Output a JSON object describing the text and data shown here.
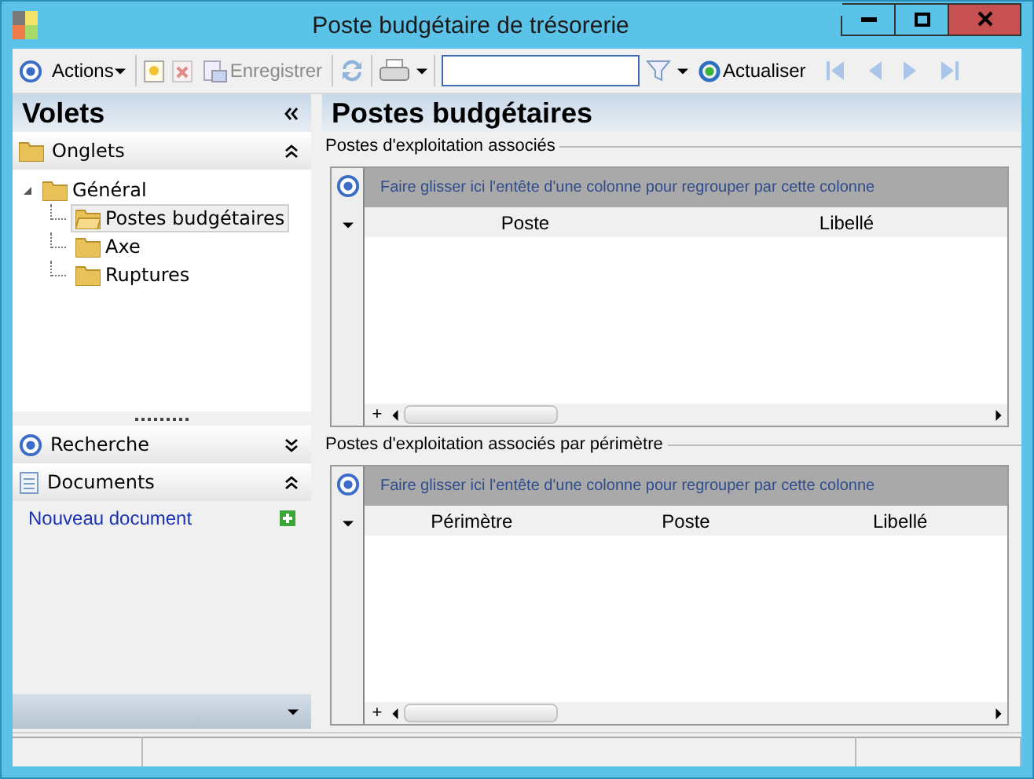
{
  "window": {
    "title": "Poste budgétaire de trésorerie"
  },
  "toolbar": {
    "actions": "Actions",
    "save": {
      "label": "Enregistrer",
      "disabled": true
    },
    "refresh": "Actualiser"
  },
  "sidebar": {
    "title": "Volets",
    "sections": [
      {
        "kind": "tree",
        "label": "Onglets",
        "expanded": true,
        "tree": [
          {
            "label": "Général",
            "expanded": true,
            "children": [
              {
                "label": "Postes budgétaires",
                "selected": true
              },
              {
                "label": "Axe",
                "selected": false
              },
              {
                "label": "Ruptures",
                "selected": false
              }
            ]
          }
        ]
      },
      {
        "kind": "search",
        "label": "Recherche",
        "expanded": false
      },
      {
        "kind": "documents",
        "label": "Documents",
        "expanded": true,
        "link": "Nouveau document"
      }
    ]
  },
  "main": {
    "title": "Postes budgétaires",
    "groups": [
      {
        "label": "Postes d'exploitation associés",
        "hint": "Faire glisser ici l'entête d'une colonne pour regrouper par cette colonne",
        "columns": [
          "Poste",
          "Libellé"
        ],
        "add_row": "+"
      },
      {
        "label": "Postes d'exploitation associés par périmètre",
        "hint": "Faire glisser ici l'entête d'une colonne pour regrouper par cette colonne",
        "columns": [
          "Périmètre",
          "Poste",
          "Libellé"
        ],
        "add_row": "+"
      }
    ]
  }
}
